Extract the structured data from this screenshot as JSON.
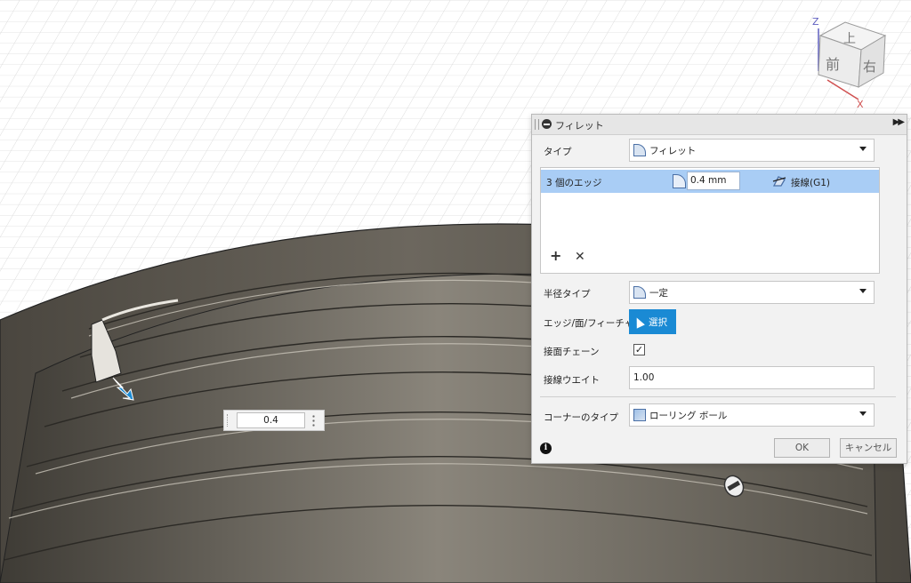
{
  "dialog": {
    "title": "フィレット",
    "type_label": "タイプ",
    "type_value": "フィレット",
    "edge_set": {
      "label": "3 個のエッジ",
      "radius": "0.4 mm",
      "tangency": "接線(G1)"
    },
    "radius_type_label": "半径タイプ",
    "radius_type_value": "一定",
    "selection_label": "エッジ/面/フィーチャ",
    "select_button": "選択",
    "tangent_chain_label": "接面チェーン",
    "tangent_chain_checked": true,
    "tangent_weight_label": "接線ウエイト",
    "tangent_weight_value": "1.00",
    "corner_type_label": "コーナーのタイプ",
    "corner_type_value": "ローリング ボール",
    "ok_label": "OK",
    "cancel_label": "キャンセル"
  },
  "floating_input": {
    "value": "0.4"
  },
  "viewcube": {
    "top": "上",
    "front": "前",
    "right": "右",
    "axis_z": "Z",
    "axis_x": "X"
  },
  "colors": {
    "accent": "#1a8ad4",
    "selected_row": "#a9cdf5",
    "model": "#5b574f"
  }
}
